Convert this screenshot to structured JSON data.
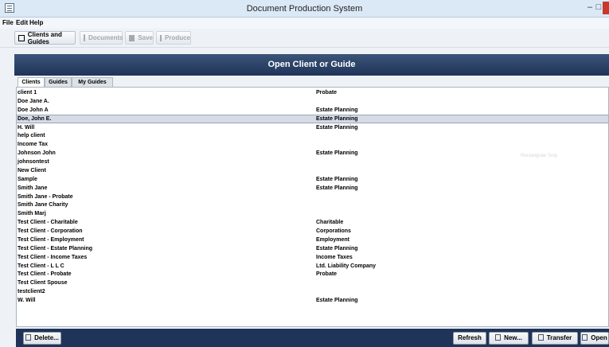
{
  "window": {
    "title": "Document Production System"
  },
  "menu": [
    "File",
    "Edit",
    "Help"
  ],
  "toolbar": {
    "clients_guides": "Clients and Guides",
    "documents": "Documents",
    "save": "Save",
    "produce": "Produce"
  },
  "panel": {
    "header": "Open Client or Guide",
    "tabs": [
      "Clients",
      "Guides",
      "My Guides"
    ],
    "selected_tab": "Clients"
  },
  "clients": [
    {
      "name": "client 1",
      "type": "Probate"
    },
    {
      "name": "Doe Jane A.",
      "type": ""
    },
    {
      "name": "Doe John A",
      "type": "Estate Planning"
    },
    {
      "name": "Doe, John E.",
      "type": "Estate Planning",
      "selected": true
    },
    {
      "name": "H. Will",
      "type": "Estate Planning"
    },
    {
      "name": "help client",
      "type": ""
    },
    {
      "name": "Income Tax",
      "type": ""
    },
    {
      "name": "Johnson John",
      "type": "Estate Planning"
    },
    {
      "name": "johnsontest",
      "type": ""
    },
    {
      "name": "New Client",
      "type": ""
    },
    {
      "name": "Sample",
      "type": "Estate Planning"
    },
    {
      "name": "Smith Jane",
      "type": "Estate Planning"
    },
    {
      "name": "Smith Jane - Probate",
      "type": ""
    },
    {
      "name": "Smith Jane Charity",
      "type": ""
    },
    {
      "name": "Smith Marj",
      "type": ""
    },
    {
      "name": "Test Client - Charitable",
      "type": "Charitable"
    },
    {
      "name": "Test Client - Corporation",
      "type": "Corporations"
    },
    {
      "name": "Test Client - Employment",
      "type": "Employment"
    },
    {
      "name": "Test Client - Estate Planning",
      "type": "Estate Planning"
    },
    {
      "name": "Test Client - Income Taxes",
      "type": "Income Taxes"
    },
    {
      "name": "Test Client - L L C",
      "type": "Ltd. Liability Company"
    },
    {
      "name": "Test Client - Probate",
      "type": "Probate"
    },
    {
      "name": "Test Client Spouse",
      "type": ""
    },
    {
      "name": "testclient2",
      "type": ""
    },
    {
      "name": "W. Will",
      "type": "Estate Planning"
    }
  ],
  "ghost_label": "Rectangular Snip",
  "buttons": {
    "delete": "Delete...",
    "refresh": "Refresh",
    "new": "New...",
    "transfer": "Transfer",
    "open": "Open"
  }
}
